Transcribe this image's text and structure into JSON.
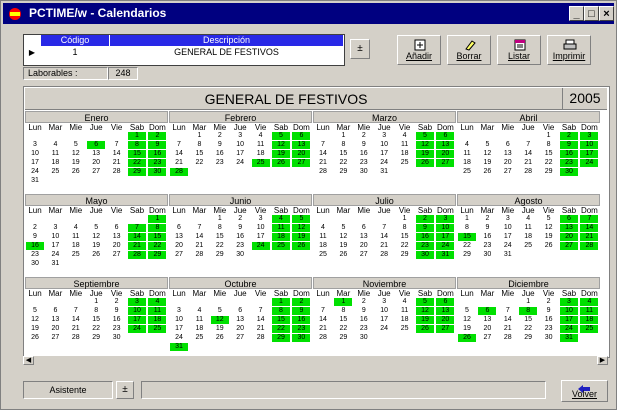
{
  "window": {
    "title": "PCTIME/w - Calendarios",
    "controls": [
      "_",
      "□",
      "×"
    ]
  },
  "grid": {
    "headers": {
      "codigo": "Código",
      "descripcion": "Descripción"
    },
    "row": {
      "codigo": "1",
      "descripcion": "GENERAL DE FESTIVOS"
    },
    "dropdown_arrow": "±"
  },
  "toolbar": {
    "add_label": "Añadir",
    "delete_label": "Borrar",
    "list_label": "Listar",
    "print_label": "Imprimir"
  },
  "laborables": {
    "label": "Laborables :",
    "value": "248"
  },
  "calendar": {
    "name": "GENERAL DE FESTIVOS",
    "year": "2005",
    "weekday_labels": [
      "Lun",
      "Mar",
      "Mie",
      "Jue",
      "Vie",
      "Sab",
      "Dom"
    ],
    "months": [
      {
        "name": "Enero",
        "start": 5,
        "days": 31,
        "holidays": [
          1,
          2,
          6,
          8,
          9,
          15,
          16,
          22,
          23,
          29,
          30
        ]
      },
      {
        "name": "Febrero",
        "start": 1,
        "days": 28,
        "holidays": [
          5,
          6,
          12,
          13,
          19,
          20,
          25,
          26,
          27,
          28
        ]
      },
      {
        "name": "Marzo",
        "start": 1,
        "days": 31,
        "holidays": [
          5,
          6,
          12,
          13,
          19,
          20,
          26,
          27
        ]
      },
      {
        "name": "Abril",
        "start": 4,
        "days": 30,
        "holidays": [
          2,
          3,
          9,
          10,
          16,
          17,
          23,
          24,
          30
        ]
      },
      {
        "name": "Mayo",
        "start": 6,
        "days": 31,
        "holidays": [
          1,
          7,
          8,
          14,
          15,
          16,
          21,
          22,
          28,
          29
        ]
      },
      {
        "name": "Junio",
        "start": 2,
        "days": 30,
        "holidays": [
          4,
          5,
          11,
          12,
          18,
          19,
          24,
          25,
          26
        ]
      },
      {
        "name": "Julio",
        "start": 4,
        "days": 31,
        "holidays": [
          2,
          3,
          9,
          10,
          16,
          17,
          23,
          24,
          30,
          31
        ]
      },
      {
        "name": "Agosto",
        "start": 0,
        "days": 31,
        "holidays": [
          6,
          7,
          13,
          14,
          15,
          20,
          21,
          27,
          28
        ]
      },
      {
        "name": "Septiembre",
        "start": 3,
        "days": 30,
        "holidays": [
          3,
          4,
          10,
          11,
          17,
          18,
          24,
          25
        ]
      },
      {
        "name": "Octubre",
        "start": 5,
        "days": 31,
        "holidays": [
          1,
          2,
          8,
          9,
          12,
          15,
          16,
          22,
          23,
          29,
          30,
          31
        ]
      },
      {
        "name": "Noviembre",
        "start": 1,
        "days": 30,
        "holidays": [
          1,
          5,
          6,
          12,
          13,
          19,
          20,
          26,
          27
        ]
      },
      {
        "name": "Diciembre",
        "start": 3,
        "days": 31,
        "holidays": [
          3,
          4,
          6,
          8,
          10,
          11,
          17,
          18,
          24,
          25,
          26,
          31
        ]
      }
    ]
  },
  "bottom": {
    "assistant_label": "Asistente",
    "assistant_arrow": "±",
    "back_label": "Volver"
  },
  "colors": {
    "holiday": "#00e000",
    "header_blue": "#2828e6",
    "titlebar": "#000080"
  }
}
